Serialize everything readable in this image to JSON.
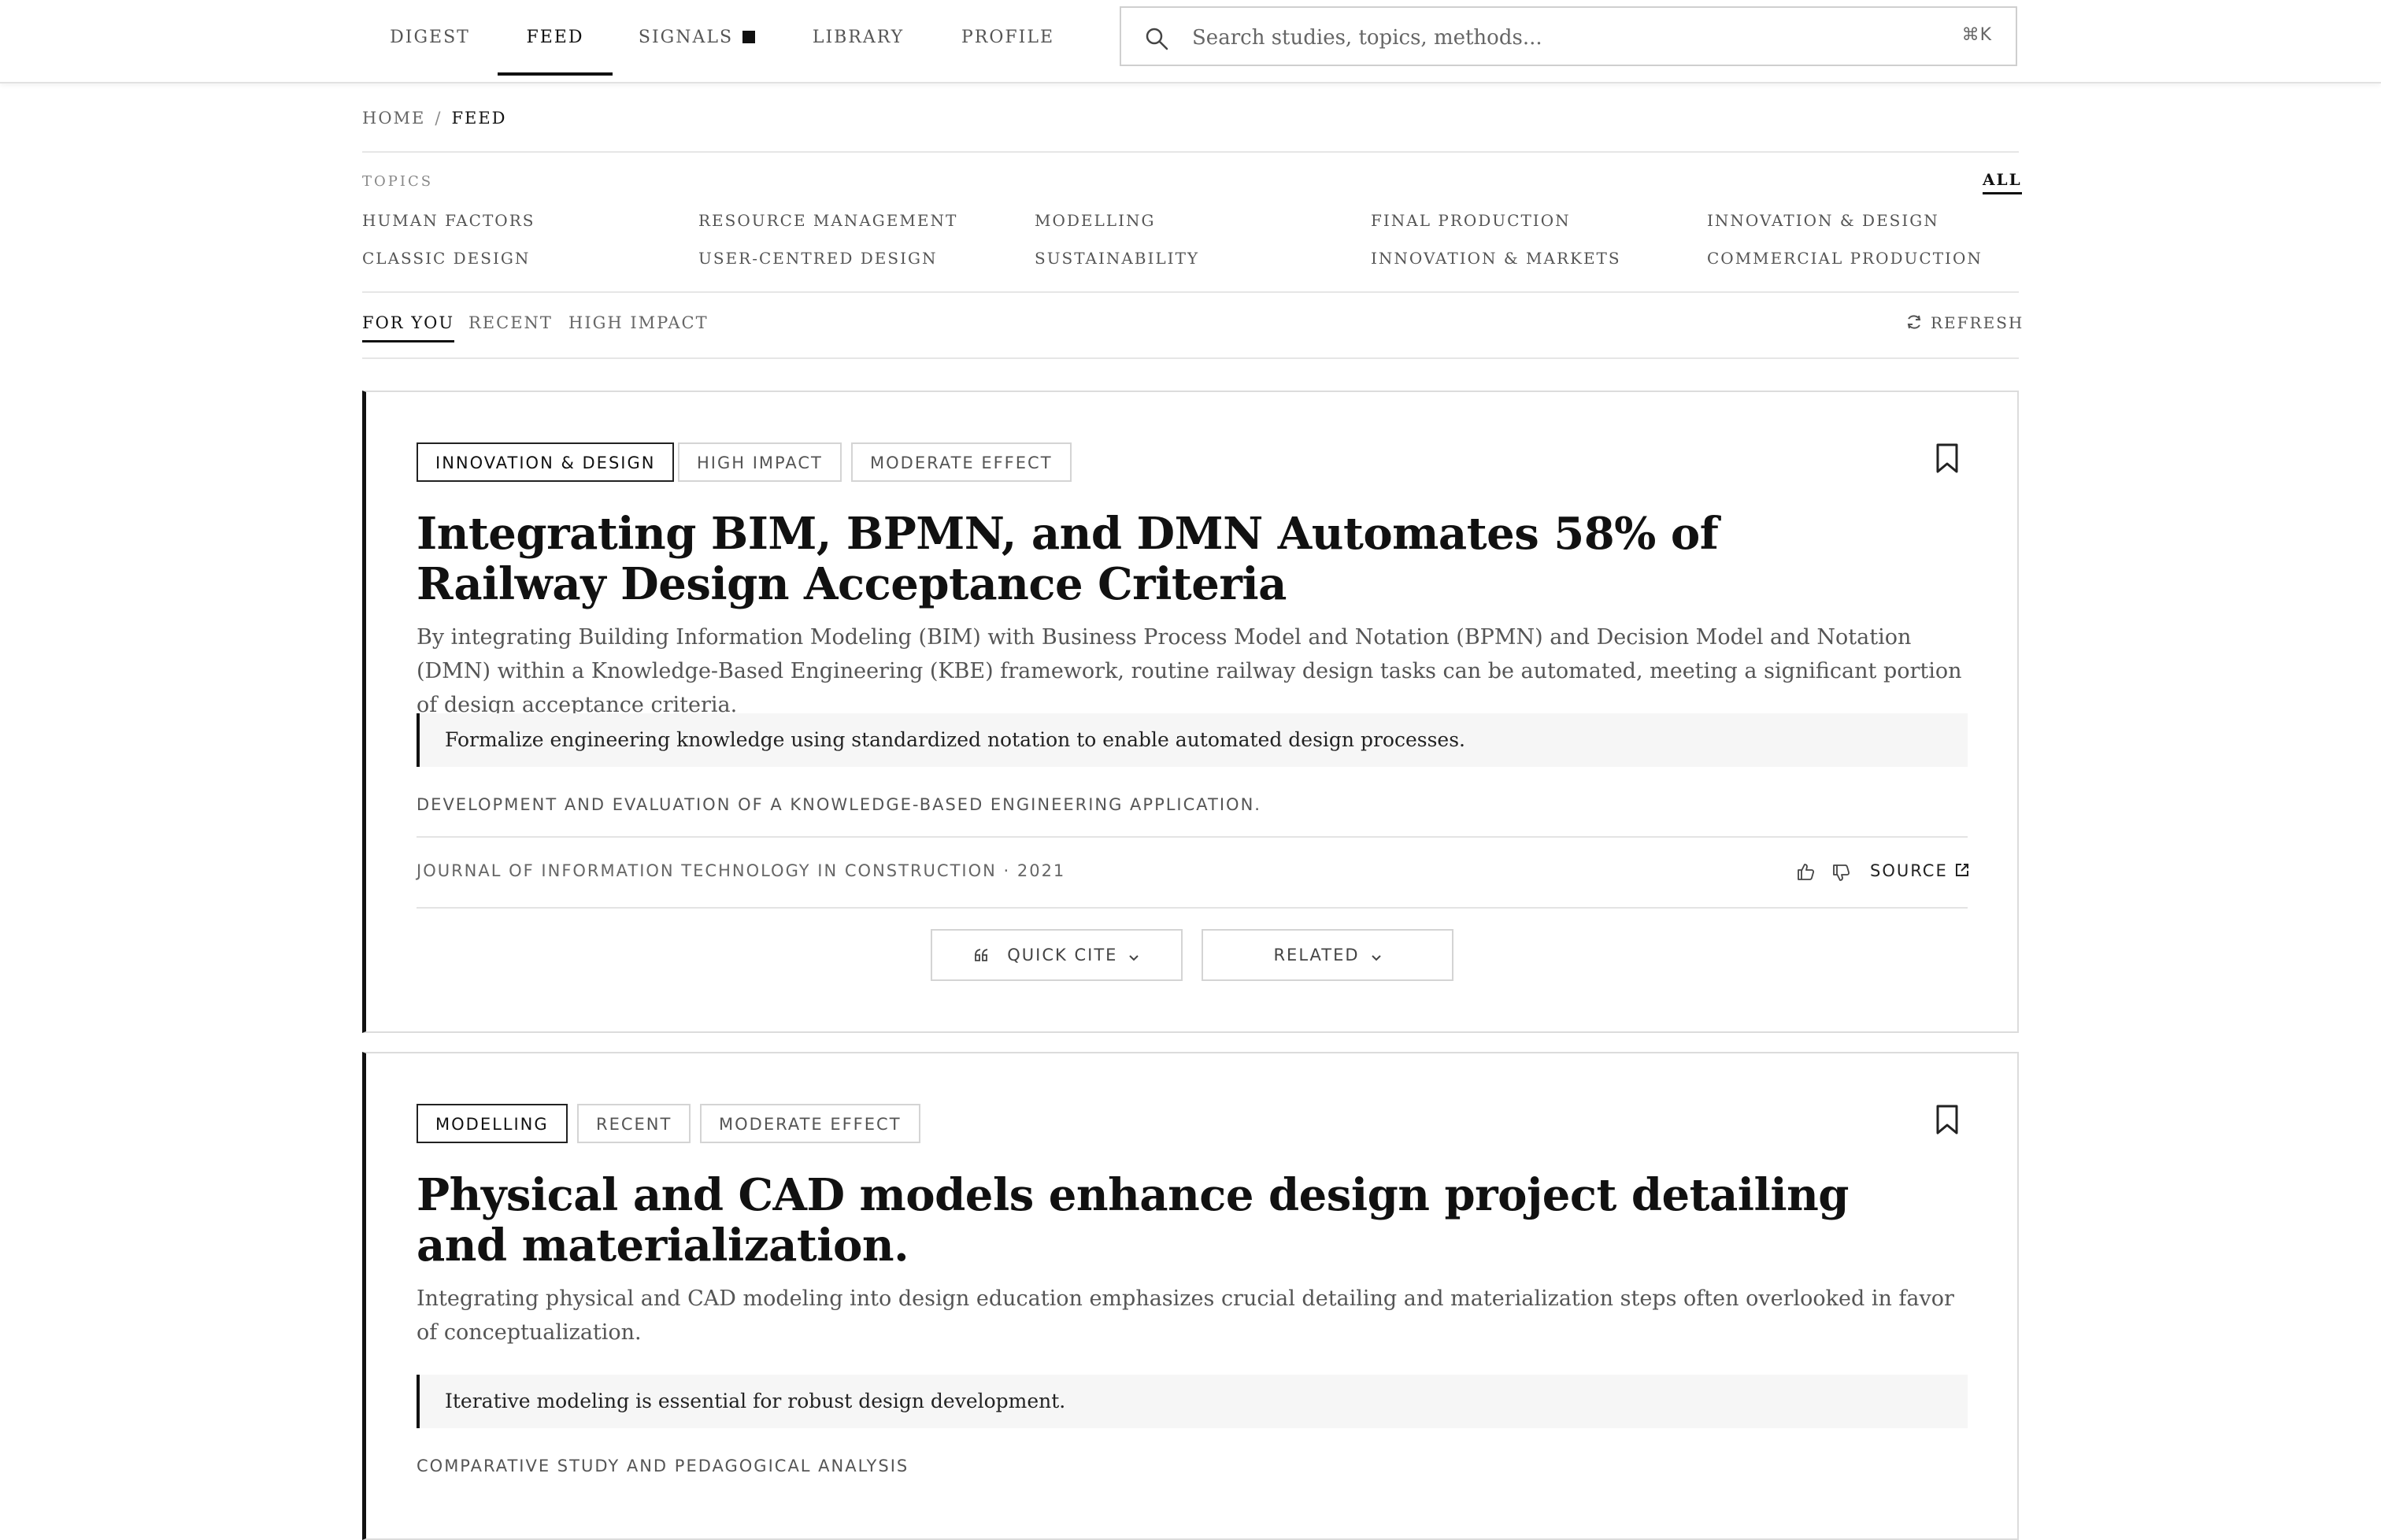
{
  "nav": {
    "items": [
      "DIGEST",
      "FEED",
      "SIGNALS",
      "LIBRARY",
      "PROFILE"
    ],
    "active": "FEED"
  },
  "search": {
    "placeholder": "Search studies, topics, methods...",
    "shortcut": "⌘K"
  },
  "breadcrumb": {
    "home": "HOME",
    "separator": "/",
    "current": "FEED"
  },
  "topics": {
    "label": "TOPICS",
    "all_label": "ALL",
    "items": [
      "HUMAN FACTORS",
      "RESOURCE MANAGEMENT",
      "MODELLING",
      "FINAL PRODUCTION",
      "INNOVATION & DESIGN",
      "CLASSIC DESIGN",
      "USER-CENTRED DESIGN",
      "SUSTAINABILITY",
      "INNOVATION & MARKETS",
      "COMMERCIAL PRODUCTION"
    ]
  },
  "feed_tabs": {
    "items": [
      "FOR YOU",
      "RECENT",
      "HIGH IMPACT"
    ],
    "active": "FOR YOU",
    "refresh_label": "REFRESH"
  },
  "cards": [
    {
      "tags": [
        "INNOVATION & DESIGN",
        "HIGH IMPACT",
        "MODERATE EFFECT"
      ],
      "title": "Integrating BIM, BPMN, and DMN Automates 58% of Railway Design Acceptance Criteria",
      "abstract": "By integrating Building Information Modeling (BIM) with Business Process Model and Notation (BPMN) and Decision Model and Notation (DMN) within a Knowledge-Based Engineering (KBE) framework, routine railway design tasks can be automated, meeting a significant portion of design acceptance criteria.",
      "takeaway": "Formalize engineering knowledge using standardized notation to enable automated design processes.",
      "method": "DEVELOPMENT AND EVALUATION OF A KNOWLEDGE-BASED ENGINEERING APPLICATION.",
      "journal": "JOURNAL OF INFORMATION TECHNOLOGY IN CONSTRUCTION · 2021",
      "source_label": "SOURCE",
      "quick_cite_label": "QUICK CITE",
      "related_label": "RELATED"
    },
    {
      "tags": [
        "MODELLING",
        "RECENT",
        "MODERATE EFFECT"
      ],
      "title": "Physical and CAD models enhance design project detailing and materialization.",
      "abstract": "Integrating physical and CAD modeling into design education emphasizes crucial detailing and materialization steps often overlooked in favor of conceptualization.",
      "takeaway": "Iterative modeling is essential for robust design development.",
      "method": "COMPARATIVE STUDY AND PEDAGOGICAL ANALYSIS"
    }
  ]
}
